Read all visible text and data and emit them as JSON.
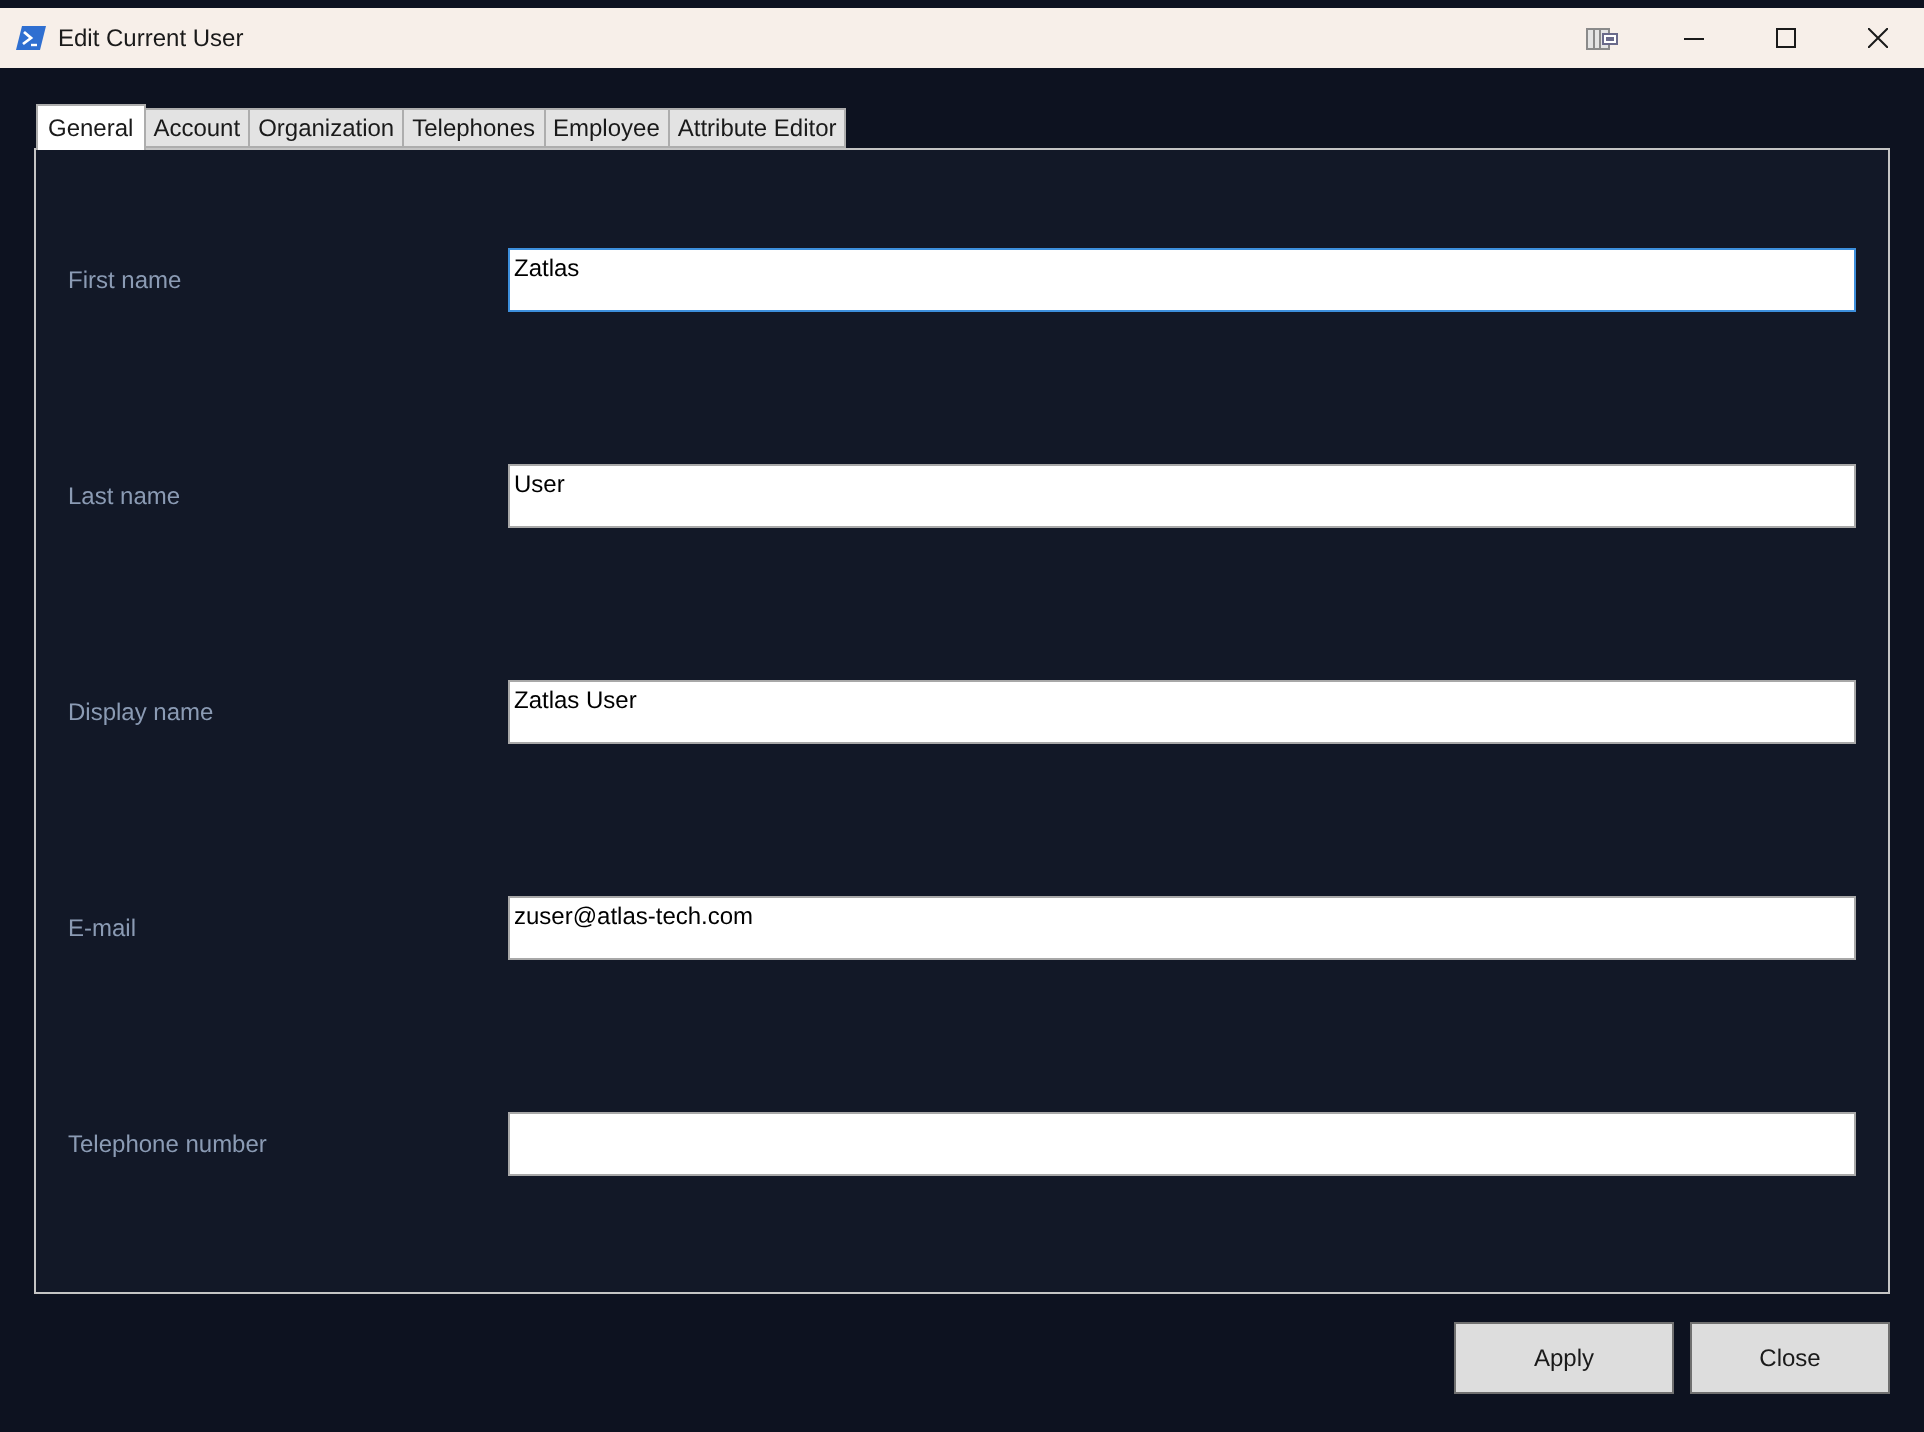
{
  "window": {
    "title": "Edit Current User"
  },
  "tabs": [
    {
      "label": "General",
      "selected": true
    },
    {
      "label": "Account",
      "selected": false
    },
    {
      "label": "Organization",
      "selected": false
    },
    {
      "label": "Telephones",
      "selected": false
    },
    {
      "label": "Employee",
      "selected": false
    },
    {
      "label": "Attribute Editor",
      "selected": false
    }
  ],
  "fields": [
    {
      "label": "First name",
      "value": "Zatlas",
      "focused": true
    },
    {
      "label": "Last name",
      "value": "User",
      "focused": false
    },
    {
      "label": "Display name",
      "value": "Zatlas User",
      "focused": false
    },
    {
      "label": "E-mail",
      "value": "zuser@atlas-tech.com",
      "focused": false
    },
    {
      "label": "Telephone number",
      "focused": false
    }
  ],
  "buttons": [
    "Apply",
    "Close"
  ]
}
